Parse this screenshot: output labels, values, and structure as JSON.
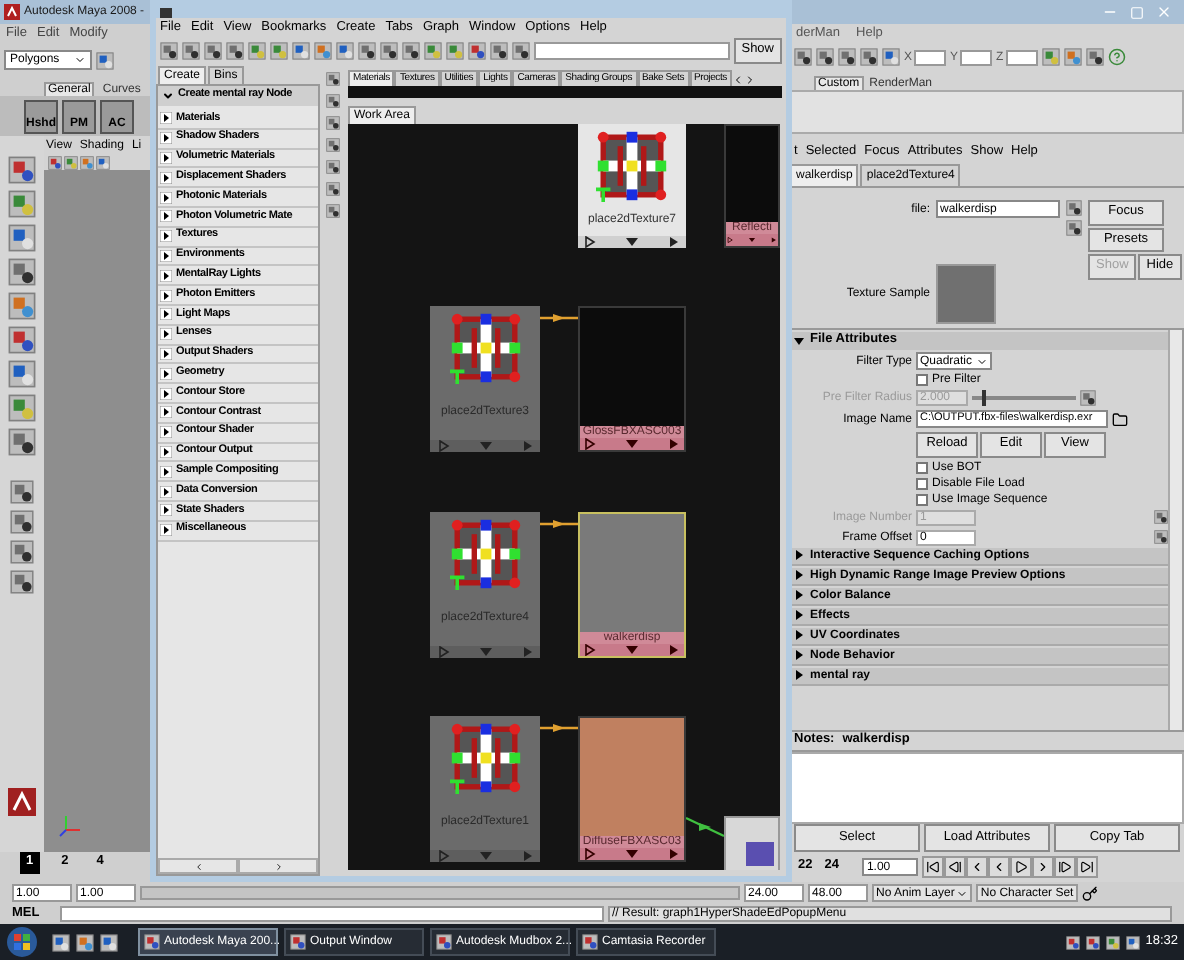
{
  "main_window": {
    "title": "Autodesk Maya 2008 -",
    "menu": [
      "File",
      "Edit",
      "Modify"
    ],
    "mode_dropdown": "Polygons",
    "shelf_tabs": [
      {
        "label": "General",
        "selected": true
      },
      {
        "label": "Curves",
        "selected": false
      }
    ],
    "shelf_buttons": [
      "Hshd",
      "PM",
      "AC"
    ],
    "panel_menu": [
      "View",
      "Shading",
      "Li"
    ],
    "right_menu": [
      "derMan",
      "Help"
    ],
    "coord_fields": [
      {
        "label": "X"
      },
      {
        "label": "Y"
      },
      {
        "label": "Z"
      }
    ],
    "right_shelf_tabs": [
      {
        "label": "Custom",
        "selected": true
      },
      {
        "label": "RenderMan",
        "selected": false
      }
    ]
  },
  "hypershade": {
    "menu": [
      "File",
      "Edit",
      "View",
      "Bookmarks",
      "Create",
      "Tabs",
      "Graph",
      "Window",
      "Options",
      "Help"
    ],
    "search_button": "Show",
    "create_tabs": [
      {
        "label": "Create",
        "selected": true
      },
      {
        "label": "Bins",
        "selected": false
      }
    ],
    "create_header": "Create mental ray Node",
    "node_categories": [
      "Materials",
      "Shadow Shaders",
      "Volumetric Materials",
      "Displacement Shaders",
      "Photonic Materials",
      "Photon Volumetric Mate",
      "Textures",
      "Environments",
      "MentalRay Lights",
      "Photon Emitters",
      "Light Maps",
      "Lenses",
      "Output Shaders",
      "Geometry",
      "Contour Store",
      "Contour Contrast",
      "Contour Shader",
      "Contour Output",
      "Sample Compositing",
      "Data Conversion",
      "State Shaders",
      "Miscellaneous"
    ],
    "tabs": [
      {
        "label": "Materials",
        "selected": true
      },
      {
        "label": "Textures",
        "selected": false
      },
      {
        "label": "Utilities",
        "selected": false
      },
      {
        "label": "Lights",
        "selected": false
      },
      {
        "label": "Cameras",
        "selected": false
      },
      {
        "label": "Shading Groups",
        "selected": false
      },
      {
        "label": "Bake Sets",
        "selected": false
      },
      {
        "label": "Projects",
        "selected": false
      }
    ],
    "work_area_tab": "Work Area",
    "nodes": [
      {
        "kind": "place2d",
        "label": "place2dTexture7",
        "selected": true,
        "connected": false
      },
      {
        "kind": "swatch",
        "label": "Reflecti",
        "color": "#0c0c0c",
        "selected": false,
        "connected": false
      },
      {
        "kind": "place2d",
        "label": "place2dTexture3",
        "selected": false,
        "connected": false
      },
      {
        "kind": "swatch",
        "label": "GlossFBXASC003",
        "color": "#0c0c0c",
        "selected": false,
        "connected": true
      },
      {
        "kind": "place2d",
        "label": "place2dTexture4",
        "selected": false,
        "connected": false
      },
      {
        "kind": "swatch",
        "label": "walkerdisp",
        "color": "#7a7a7a",
        "selected": true,
        "connected": true
      },
      {
        "kind": "place2d",
        "label": "place2dTexture1",
        "selected": false,
        "connected": false
      },
      {
        "kind": "swatch",
        "label": "DiffuseFBXASC03",
        "color": "#c08060",
        "selected": false,
        "connected": true
      },
      {
        "kind": "mini",
        "color": "#5a4fb0",
        "selected": false,
        "connected": true
      }
    ]
  },
  "attribute_editor": {
    "menu": [
      "t",
      "Selected",
      "Focus",
      "Attributes",
      "Show",
      "Help"
    ],
    "tabs": [
      {
        "label": "walkerdisp",
        "selected": true
      },
      {
        "label": "place2dTexture4",
        "selected": false
      }
    ],
    "file_label": "file:",
    "file_value": "walkerdisp",
    "side_buttons": [
      {
        "label": "Focus",
        "disabled": false
      },
      {
        "label": "Presets",
        "disabled": false
      },
      {
        "label": "Show",
        "disabled": true
      },
      {
        "label": "Hide",
        "disabled": false
      }
    ],
    "texture_sample_label": "Texture Sample",
    "section": {
      "title": "File Attributes",
      "expanded": true
    },
    "filter_type_label": "Filter Type",
    "filter_type": "Quadratic",
    "pre_filter": {
      "label": "Pre Filter",
      "checked": false
    },
    "pre_filter_radius": {
      "label": "Pre Filter Radius",
      "value": "2.000",
      "disabled": true,
      "level": 0.1
    },
    "image_name_label": "Image Name",
    "image_name": "C:\\OUTPUT.fbx-files\\walkerdisp.exr",
    "image_buttons": [
      "Reload",
      "Edit",
      "View"
    ],
    "checkboxes": [
      {
        "label": "Use BOT",
        "checked": false
      },
      {
        "label": "Disable File Load",
        "checked": false
      },
      {
        "label": "Use Image Sequence",
        "checked": false
      }
    ],
    "number_fields": [
      {
        "label": "Image Number",
        "value": "1",
        "disabled": true
      },
      {
        "label": "Frame Offset",
        "value": "0",
        "disabled": false
      }
    ],
    "sections": [
      {
        "title": "Interactive Sequence Caching Options",
        "expanded": false
      },
      {
        "title": "High Dynamic Range Image Preview Options",
        "expanded": false
      },
      {
        "title": "Color Balance",
        "expanded": false
      },
      {
        "title": "Effects",
        "expanded": false
      },
      {
        "title": "UV Coordinates",
        "expanded": false
      },
      {
        "title": "Node Behavior",
        "expanded": false
      },
      {
        "title": "mental ray",
        "expanded": false
      }
    ],
    "notes_label": "Notes:",
    "notes_node": "walkerdisp",
    "bottom_buttons": [
      "Select",
      "Load Attributes",
      "Copy Tab"
    ]
  },
  "time_slider": {
    "left_ticks": [
      {
        "label": "1",
        "selected": true
      },
      {
        "label": "2",
        "selected": false
      },
      {
        "label": "4",
        "selected": false
      }
    ],
    "right_ticks": [
      {
        "label": "22",
        "selected": false
      },
      {
        "label": "24",
        "selected": false
      }
    ],
    "current_time": "1.00"
  },
  "range_slider": {
    "level": 1,
    "start_fields": [
      "1.00",
      "1.00"
    ],
    "end_fields": [
      "24.00",
      "48.00"
    ],
    "anim_layer": "No Anim Layer",
    "character_set": "No Character Set"
  },
  "command_line": {
    "label": "MEL",
    "result": "// Result: graph1HyperShadeEdPopupMenu"
  },
  "taskbar": {
    "tasks": [
      {
        "label": "Autodesk Maya 200...",
        "selected": true
      },
      {
        "label": "Output Window",
        "selected": false
      },
      {
        "label": "Autodesk Mudbox 2...",
        "selected": false
      },
      {
        "label": "Camtasia Recorder",
        "selected": false
      }
    ],
    "clock": "18:32"
  }
}
